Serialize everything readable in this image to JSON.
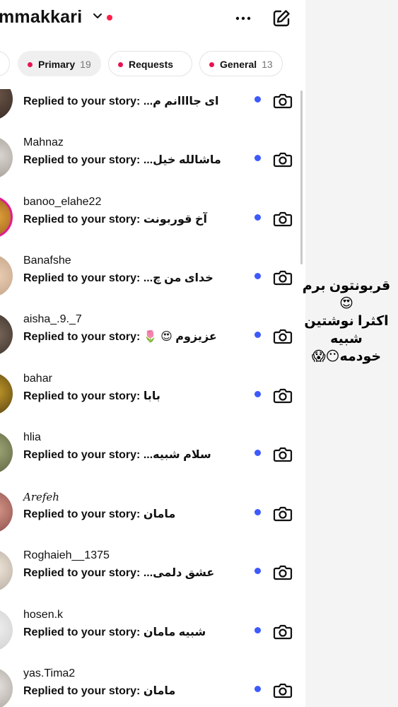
{
  "header": {
    "username": "mmakkari"
  },
  "filters": [
    {
      "label": "Primary",
      "count": "19"
    },
    {
      "label": "Requests",
      "count": ""
    },
    {
      "label": "General",
      "count": "13"
    }
  ],
  "threads": [
    {
      "name": "",
      "preview_prefix": "Replied to your story:",
      "message": "ای جاااانم م..."
    },
    {
      "name": "Mahnaz",
      "preview_prefix": "Replied to your story:",
      "message": "ماشالله خیل..."
    },
    {
      "name": "banoo_elahe22",
      "preview_prefix": "Replied to your story:",
      "message": "آخ قوربونت"
    },
    {
      "name": "Banafshe",
      "preview_prefix": "Replied to your story:",
      "message": "خدای من چ..."
    },
    {
      "name": "aisha_.9._7",
      "preview_prefix": "Replied to your story:",
      "message": "عزیزوم 😍 🌷"
    },
    {
      "name": "bahar",
      "preview_prefix": "Replied to your story:",
      "message": "بابا"
    },
    {
      "name": "hlia",
      "preview_prefix": "Replied to your story:",
      "message": "سلام شبیه..."
    },
    {
      "name": "𝐴𝑟𝑒𝑓𝑒ℎ",
      "preview_prefix": "Replied to your story:",
      "message": "مامان"
    },
    {
      "name": "Roghaieh__1375",
      "preview_prefix": "Replied to your story:",
      "message": "عشق دلمی..."
    },
    {
      "name": "hosen.k",
      "preview_prefix": "Replied to your story:",
      "message": "شبیه مامان"
    },
    {
      "name": "yas.Tima2",
      "preview_prefix": "Replied to your story:",
      "message": "مامان"
    }
  ],
  "overlay": {
    "line1": "قربونتون برم",
    "line2": "😍",
    "line3": "اکثرا نوشتین",
    "line4": "شبیه",
    "line5": "خودمه😶😱"
  },
  "colors": {
    "unread_dot": "#3d5afe",
    "notification_dot": "#ff1f4b",
    "story_ring": "#e11d8f"
  },
  "icons": {
    "more": "more-icon",
    "compose": "compose-icon",
    "camera": "camera-icon",
    "chevron": "chevron-down-icon"
  }
}
